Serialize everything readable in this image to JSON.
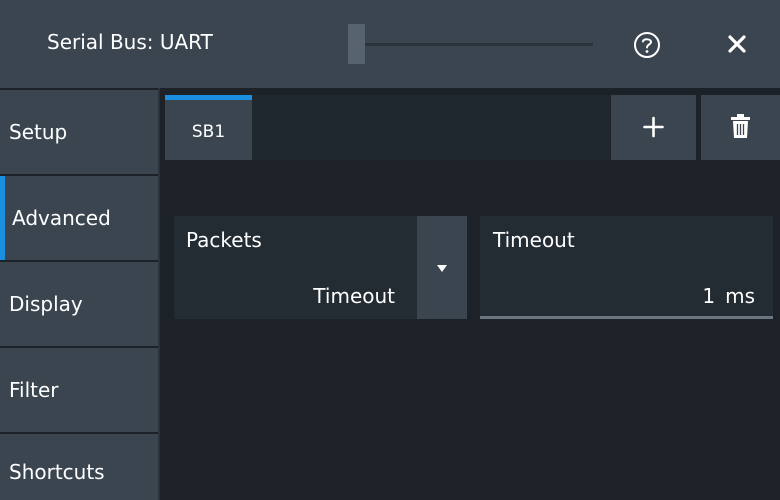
{
  "window": {
    "title": "Serial Bus: UART",
    "help_icon": "question-circle-icon",
    "close_icon": "close-icon"
  },
  "sidebar": {
    "items": [
      {
        "label": "Setup"
      },
      {
        "label": "Advanced"
      },
      {
        "label": "Display"
      },
      {
        "label": "Filter"
      },
      {
        "label": "Shortcuts"
      }
    ],
    "active_item": "Advanced"
  },
  "tabs": {
    "items": [
      {
        "label": "SB1"
      }
    ],
    "add_icon": "plus-icon",
    "delete_icon": "trash-icon"
  },
  "packets": {
    "label": "Packets",
    "value": "Timeout",
    "dropdown_icon": "caret-down-icon"
  },
  "timeout": {
    "label": "Timeout",
    "value": "1",
    "unit": "ms"
  },
  "colors": {
    "accent": "#1a8fe0",
    "panel": "#3a4550",
    "background": "#1c2228",
    "field": "#232b33"
  }
}
